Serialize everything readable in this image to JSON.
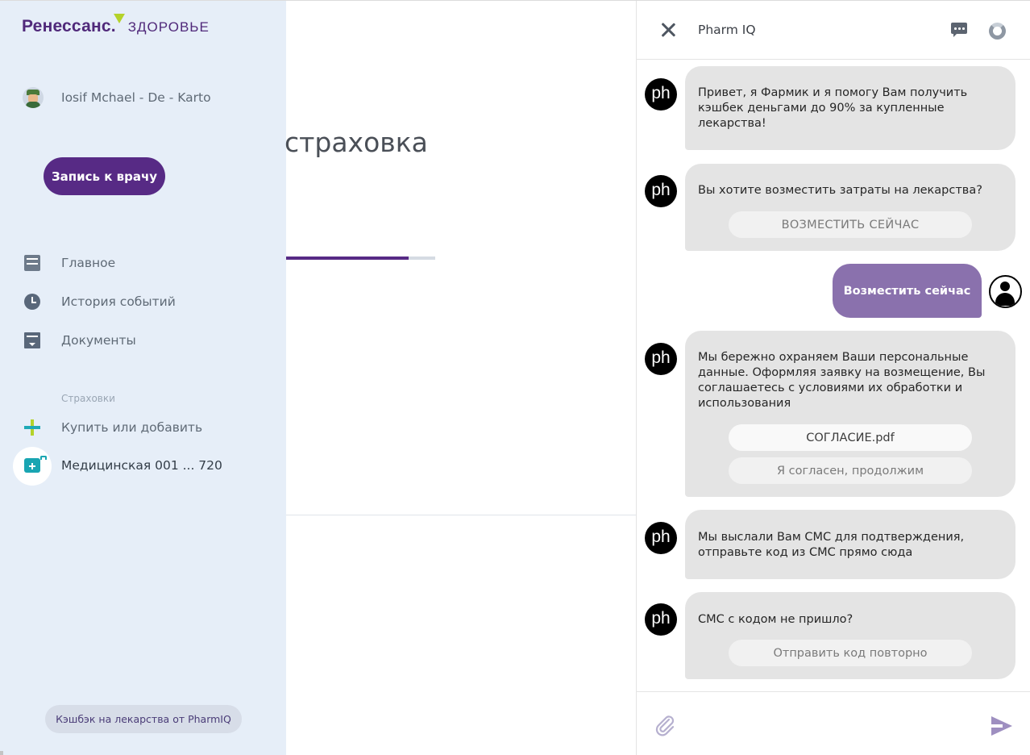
{
  "sidebar": {
    "logo": {
      "brand": "Ренессанс.",
      "sub": "ЗДОРОВЬЕ",
      "tick_color": "#b4d22a",
      "brand_color": "#50297a"
    },
    "user": {
      "name": "Iosif Mchael - De - Karto",
      "avatar_icon": "user-avatar-icon"
    },
    "appointment_button": "Запись к врачу",
    "nav": [
      {
        "label": "Главное",
        "icon": "home-icon"
      },
      {
        "label": "История событий",
        "icon": "clock-icon"
      },
      {
        "label": "Документы",
        "icon": "document-icon"
      }
    ],
    "insurance_section_title": "Страховки",
    "insurance_items": [
      {
        "label": "Купить или добавить",
        "icon": "plus-icon"
      },
      {
        "label": "Медицинская 001 ... 720",
        "icon": "medical-kit-icon",
        "active": true
      }
    ],
    "cashback_button": "Кэшбэк на лекарства от PharmIQ"
  },
  "main": {
    "heading": "страховка",
    "progress_fraction": 0.82,
    "accent_color": "#572a85"
  },
  "chat": {
    "header": {
      "title": "Pharm IQ",
      "close_icon": "close-icon",
      "message_icon": "chat-bubble-icon",
      "status_icon": "ring-icon"
    },
    "bot_avatar_text": "ph",
    "messages": [
      {
        "from": "bot",
        "lines": [
          "Привет, я Фармик и я помогу Вам получить",
          "кэшбек деньгами до 90% за купленные",
          "лекарства!"
        ]
      },
      {
        "from": "bot",
        "lines": [
          "Вы хотите возместить затраты на лекарства?"
        ],
        "buttons": [
          "ВОЗМЕСТИТЬ СЕЙЧАС"
        ]
      },
      {
        "from": "user",
        "text": "Возместить сейчас"
      },
      {
        "from": "bot",
        "lines": [
          "Мы бережно охраняем Ваши персональные",
          "данные. Оформляя заявку на возмещение, Вы",
          "соглашаетесь с условиями их обработки и",
          "использования"
        ],
        "buttons": [
          "СОГЛАСИЕ.pdf",
          "Я согласен, продолжим"
        ]
      },
      {
        "from": "bot",
        "lines": [
          "Мы выслали Вам СМС для подтверждения,",
          "отправьте код из СМС прямо сюда"
        ]
      },
      {
        "from": "bot",
        "lines": [
          "СМС с кодом не пришло?"
        ],
        "buttons": [
          "Отправить код повторно"
        ]
      }
    ],
    "footer": {
      "attach_icon": "paperclip-icon",
      "send_icon": "send-icon"
    },
    "colors": {
      "bot_bubble": "#e4e4e4",
      "user_bubble": "#8a71ad"
    }
  }
}
